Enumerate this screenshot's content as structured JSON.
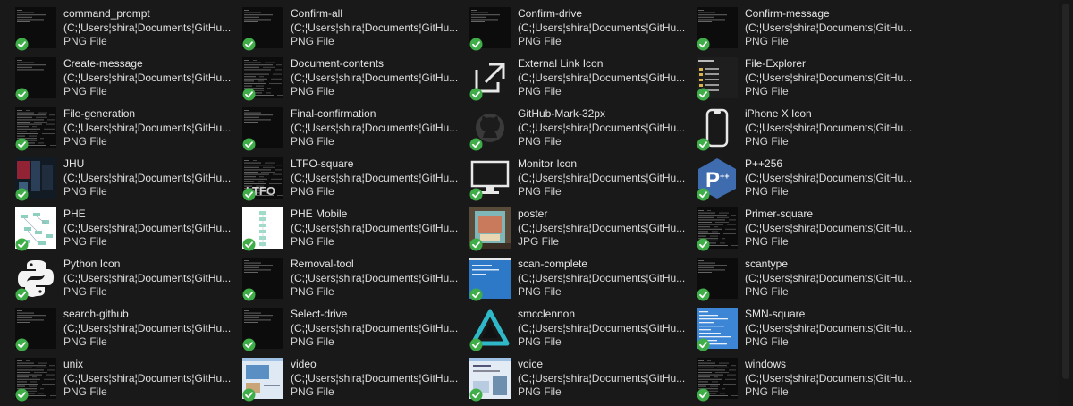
{
  "files": [
    {
      "name": "command_prompt",
      "path": "(C;¦Users¦shira¦Documents¦GitHu...",
      "type": "PNG File",
      "thumb": "console-dark-icon"
    },
    {
      "name": "Confirm-all",
      "path": "(C;¦Users¦shira¦Documents¦GitHu...",
      "type": "PNG File",
      "thumb": "console-dark-icon"
    },
    {
      "name": "Confirm-drive",
      "path": "(C;¦Users¦shira¦Documents¦GitHu...",
      "type": "PNG File",
      "thumb": "console-dark-icon"
    },
    {
      "name": "Confirm-message",
      "path": "(C;¦Users¦shira¦Documents¦GitHu...",
      "type": "PNG File",
      "thumb": "console-dark-icon"
    },
    {
      "name": "Create-message",
      "path": "(C;¦Users¦shira¦Documents¦GitHu...",
      "type": "PNG File",
      "thumb": "console-dark-icon"
    },
    {
      "name": "Document-contents",
      "path": "(C;¦Users¦shira¦Documents¦GitHu...",
      "type": "PNG File",
      "thumb": "console-dense-icon"
    },
    {
      "name": "External Link Icon",
      "path": "(C;¦Users¦shira¦Documents¦GitHu...",
      "type": "PNG File",
      "thumb": "external-link-icon"
    },
    {
      "name": "File-Explorer",
      "path": "(C;¦Users¦shira¦Documents¦GitHu...",
      "type": "PNG File",
      "thumb": "file-explorer-thumb-icon"
    },
    {
      "name": "File-generation",
      "path": "(C;¦Users¦shira¦Documents¦GitHu...",
      "type": "PNG File",
      "thumb": "console-dense-icon"
    },
    {
      "name": "Final-confirmation",
      "path": "(C;¦Users¦shira¦Documents¦GitHu...",
      "type": "PNG File",
      "thumb": "console-dark-icon"
    },
    {
      "name": "GitHub-Mark-32px",
      "path": "(C;¦Users¦shira¦Documents¦GitHu...",
      "type": "PNG File",
      "thumb": "github-mark-icon"
    },
    {
      "name": "iPhone X Icon",
      "path": "(C;¦Users¦shira¦Documents¦GitHu...",
      "type": "PNG File",
      "thumb": "iphone-icon"
    },
    {
      "name": "JHU",
      "path": "(C;¦Users¦shira¦Documents¦GitHu...",
      "type": "PNG File",
      "thumb": "jhu-thumb-icon"
    },
    {
      "name": "LTFO-square",
      "path": "(C;¦Users¦shira¦Documents¦GitHu...",
      "type": "PNG File",
      "thumb": "ltfo-square-icon"
    },
    {
      "name": "Monitor Icon",
      "path": "(C;¦Users¦shira¦Documents¦GitHu...",
      "type": "PNG File",
      "thumb": "monitor-icon"
    },
    {
      "name": "P++256",
      "path": "(C;¦Users¦shira¦Documents¦GitHu...",
      "type": "PNG File",
      "thumb": "p-plus-plus-logo-icon"
    },
    {
      "name": "PHE",
      "path": "(C;¦Users¦shira¦Documents¦GitHu...",
      "type": "PNG File",
      "thumb": "diagram-white-icon"
    },
    {
      "name": "PHE Mobile",
      "path": "(C;¦Users¦shira¦Documents¦GitHu...",
      "type": "PNG File",
      "thumb": "diagram-mobile-icon"
    },
    {
      "name": "poster",
      "path": "(C;¦Users¦shira¦Documents¦GitHu...",
      "type": "JPG File",
      "thumb": "poster-photo-icon"
    },
    {
      "name": "Primer-square",
      "path": "(C;¦Users¦shira¦Documents¦GitHu...",
      "type": "PNG File",
      "thumb": "console-dense-icon"
    },
    {
      "name": "Python Icon",
      "path": "(C;¦Users¦shira¦Documents¦GitHu...",
      "type": "PNG File",
      "thumb": "python-logo-icon"
    },
    {
      "name": "Removal-tool",
      "path": "(C;¦Users¦shira¦Documents¦GitHu...",
      "type": "PNG File",
      "thumb": "console-dark-icon"
    },
    {
      "name": "scan-complete",
      "path": "(C;¦Users¦shira¦Documents¦GitHu...",
      "type": "PNG File",
      "thumb": "blue-window-icon"
    },
    {
      "name": "scantype",
      "path": "(C;¦Users¦shira¦Documents¦GitHu...",
      "type": "PNG File",
      "thumb": "console-dark-icon"
    },
    {
      "name": "search-github",
      "path": "(C;¦Users¦shira¦Documents¦GitHu...",
      "type": "PNG File",
      "thumb": "console-dark-icon"
    },
    {
      "name": "Select-drive",
      "path": "(C;¦Users¦shira¦Documents¦GitHu...",
      "type": "PNG File",
      "thumb": "console-dark-icon"
    },
    {
      "name": "smcclennon",
      "path": "(C;¦Users¦shira¦Documents¦GitHu...",
      "type": "PNG File",
      "thumb": "triangle-logo-icon"
    },
    {
      "name": "SMN-square",
      "path": "(C;¦Users¦shira¦Documents¦GitHu...",
      "type": "PNG File",
      "thumb": "blue-console-icon"
    },
    {
      "name": "unix",
      "path": "(C;¦Users¦shira¦Documents¦GitHu...",
      "type": "PNG File",
      "thumb": "console-dense-icon"
    },
    {
      "name": "video",
      "path": "(C;¦Users¦shira¦Documents¦GitHu...",
      "type": "PNG File",
      "thumb": "video-window-icon"
    },
    {
      "name": "voice",
      "path": "(C;¦Users¦shira¦Documents¦GitHu...",
      "type": "PNG File",
      "thumb": "voice-window-icon"
    },
    {
      "name": "windows",
      "path": "(C;¦Users¦shira¦Documents¦GitHu...",
      "type": "PNG File",
      "thumb": "console-dense-icon"
    }
  ],
  "colors": {
    "background": "#191919",
    "status_ok": "#3fae48",
    "text": "#dedede"
  }
}
